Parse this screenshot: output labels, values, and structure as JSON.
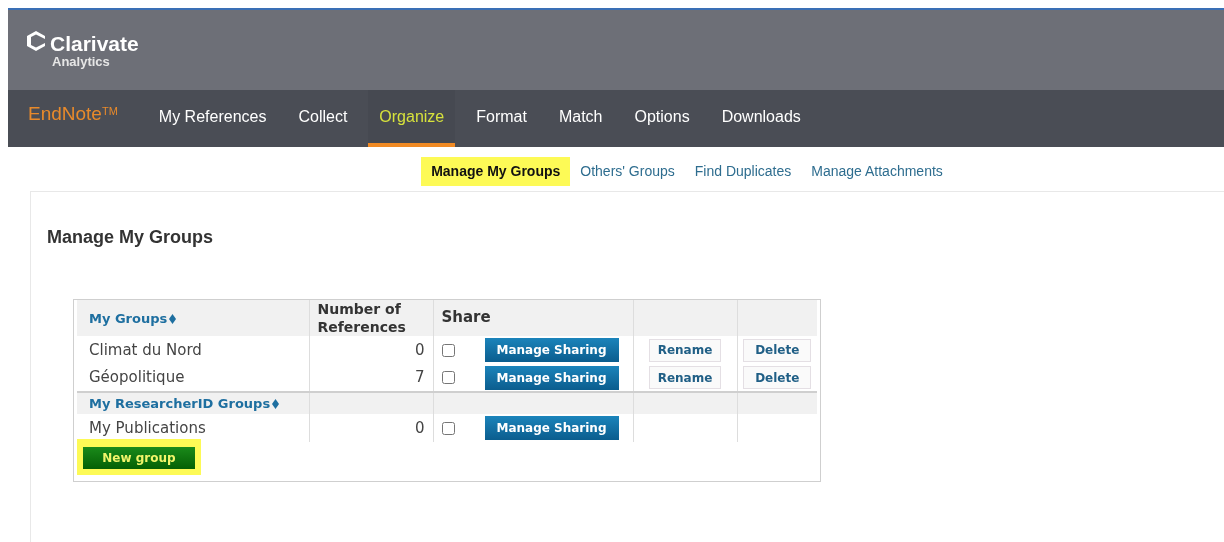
{
  "brand": {
    "name": "Clarivate",
    "sub": "Analytics"
  },
  "nav": {
    "product": "EndNote",
    "product_mark": "TM",
    "items": [
      {
        "label": "My References",
        "selected": false
      },
      {
        "label": "Collect",
        "selected": false
      },
      {
        "label": "Organize",
        "selected": true
      },
      {
        "label": "Format",
        "selected": false
      },
      {
        "label": "Match",
        "selected": false
      },
      {
        "label": "Options",
        "selected": false
      },
      {
        "label": "Downloads",
        "selected": false
      }
    ]
  },
  "subnav": [
    {
      "label": "Manage My Groups",
      "selected": true,
      "highlighted": true
    },
    {
      "label": "Others' Groups",
      "selected": false,
      "highlighted": false
    },
    {
      "label": "Find Duplicates",
      "selected": false,
      "highlighted": false
    },
    {
      "label": "Manage Attachments",
      "selected": false,
      "highlighted": false
    }
  ],
  "page_title": "Manage My Groups",
  "table": {
    "columns": [
      "Number of References",
      "Share"
    ],
    "sections": [
      {
        "heading": "My Groups",
        "rows": [
          {
            "name": "Climat du Nord",
            "count": "0",
            "shared": false,
            "actions": [
              {
                "label": "Manage Sharing",
                "kind": "primary"
              },
              {
                "label": "Rename",
                "kind": "secondary"
              },
              {
                "label": "Delete",
                "kind": "secondary"
              }
            ]
          },
          {
            "name": "Géopolitique",
            "count": "7",
            "shared": false,
            "actions": [
              {
                "label": "Manage Sharing",
                "kind": "primary"
              },
              {
                "label": "Rename",
                "kind": "secondary"
              },
              {
                "label": "Delete",
                "kind": "secondary"
              }
            ]
          }
        ]
      },
      {
        "heading": "My ResearcherID Groups",
        "rows": [
          {
            "name": "My Publications",
            "count": "0",
            "shared": false,
            "actions": [
              {
                "label": "Manage Sharing",
                "kind": "primary"
              }
            ]
          }
        ]
      }
    ]
  },
  "new_group": {
    "label": "New group",
    "highlighted": true
  }
}
